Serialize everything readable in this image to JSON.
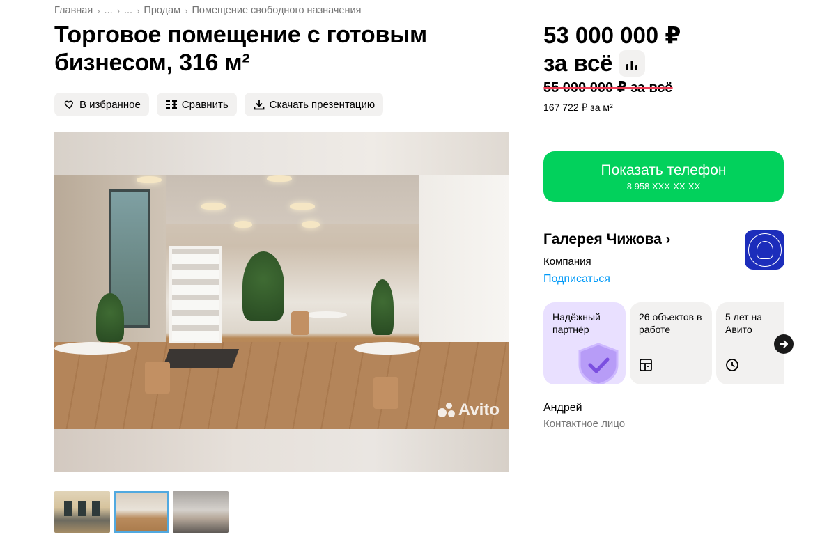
{
  "breadcrumb": {
    "items": [
      "Главная",
      "...",
      "...",
      "Продам",
      "Помещение свободного назначения"
    ]
  },
  "title": "Торговое помещение с готовым бизнесом, 316 м²",
  "actions": {
    "favorite": "В избранное",
    "compare": "Сравнить",
    "download": "Скачать презентацию"
  },
  "gallery": {
    "watermark": "Avito",
    "selected_thumb": 2
  },
  "price": {
    "main": "53 000 000 ₽",
    "suffix": "за всё",
    "old": "55 000 000 ₽ за всё",
    "per_m2": "167 722 ₽ за м²"
  },
  "phone": {
    "label": "Показать телефон",
    "masked": "8 958 XXX-XX-XX"
  },
  "seller": {
    "name": "Галерея Чижова ›",
    "type": "Компания",
    "subscribe": "Подписаться"
  },
  "badges": [
    {
      "text": "Надёжный партнёр",
      "icon": "shield-check-icon"
    },
    {
      "text": "26 объектов в работе",
      "icon": "listing-icon"
    },
    {
      "text": "5 лет на Авито",
      "icon": "clock-icon"
    }
  ],
  "contact": {
    "name": "Андрей",
    "role": "Контактное лицо"
  },
  "colors": {
    "accent_green": "#02d15c",
    "link_blue": "#0099f7",
    "strike_red": "#ef3e56",
    "badge_purple": "#e9e0ff",
    "logo_blue": "#1c2dbb"
  }
}
